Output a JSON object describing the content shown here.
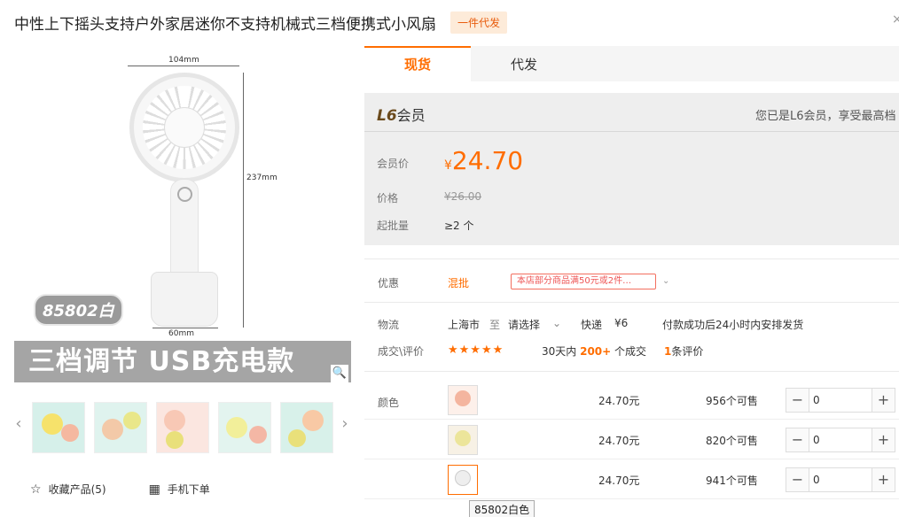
{
  "product": {
    "title": "中性上下摇头支持户外家居迷你不支持机械式三档便携式小风扇",
    "badge": "一件代发",
    "close": "×"
  },
  "gallery": {
    "dim_width": "104mm",
    "dim_height": "237mm",
    "dim_base": "60mm",
    "model_tag": "85802白",
    "banner": "三档调节 USB充电款",
    "zoom_icon": "🔍"
  },
  "thumbs": {
    "prev": "‹",
    "next": "›",
    "items": [
      {
        "name": "thumb-1",
        "color1": "#f6e26b",
        "color2": "#f5b8a0"
      },
      {
        "name": "thumb-2",
        "color1": "#f3c9a8",
        "color2": "#e9e78a"
      },
      {
        "name": "thumb-3",
        "color1": "#f8c8b5",
        "color2": "#e9e07a"
      },
      {
        "name": "thumb-4",
        "color1": "#f2ef9a",
        "color2": "#f4b7a5"
      },
      {
        "name": "thumb-5",
        "color1": "#f8c9a5",
        "color2": "#e9e07a"
      }
    ]
  },
  "actions": {
    "favorite_icon": "☆",
    "favorite_label": "收藏产品(5)",
    "mobile_icon": "▦",
    "mobile_label": "手机下单"
  },
  "tabs": [
    {
      "label": "现货",
      "active": true
    },
    {
      "label": "代发",
      "active": false
    }
  ],
  "member": {
    "level_prefix": "L6",
    "level_suffix": "会员",
    "note": "您已是L6会员，享受最高档"
  },
  "prices": {
    "member_label": "会员价",
    "currency": "¥",
    "member_price": "24.70",
    "price_label": "价格",
    "orig_price": "¥26.00",
    "moq_label": "起批量",
    "moq_value": "≥2 个"
  },
  "promo": {
    "label": "优惠",
    "tag": "混批",
    "text": "本店部分商品满50元或2件…",
    "arrow": "⌄"
  },
  "logistics": {
    "label": "物流",
    "from": "上海市",
    "to_word": "至",
    "dest": "请选择",
    "dest_arrow": "⌄",
    "method": "快递",
    "fee": "¥6",
    "ship_note": "付款成功后24小时内安排发货"
  },
  "deals": {
    "label": "成交\\评价",
    "stars": "★★★★★",
    "period": "30天内",
    "count": "200+",
    "count_suffix": "个成交",
    "reviews": "1",
    "reviews_suffix": "条评价"
  },
  "sku": {
    "label": "颜色",
    "tooltip": "85802白色",
    "rows": [
      {
        "price": "24.70元",
        "stock": "956个可售",
        "qty": "0",
        "dot": "#f4b59f",
        "selected": false
      },
      {
        "price": "24.70元",
        "stock": "820个可售",
        "qty": "0",
        "dot": "#ece59a",
        "selected": false
      },
      {
        "price": "24.70元",
        "stock": "941个可售",
        "qty": "0",
        "dot": "#eeeeee",
        "selected": true
      }
    ],
    "minus": "−",
    "plus": "+"
  }
}
